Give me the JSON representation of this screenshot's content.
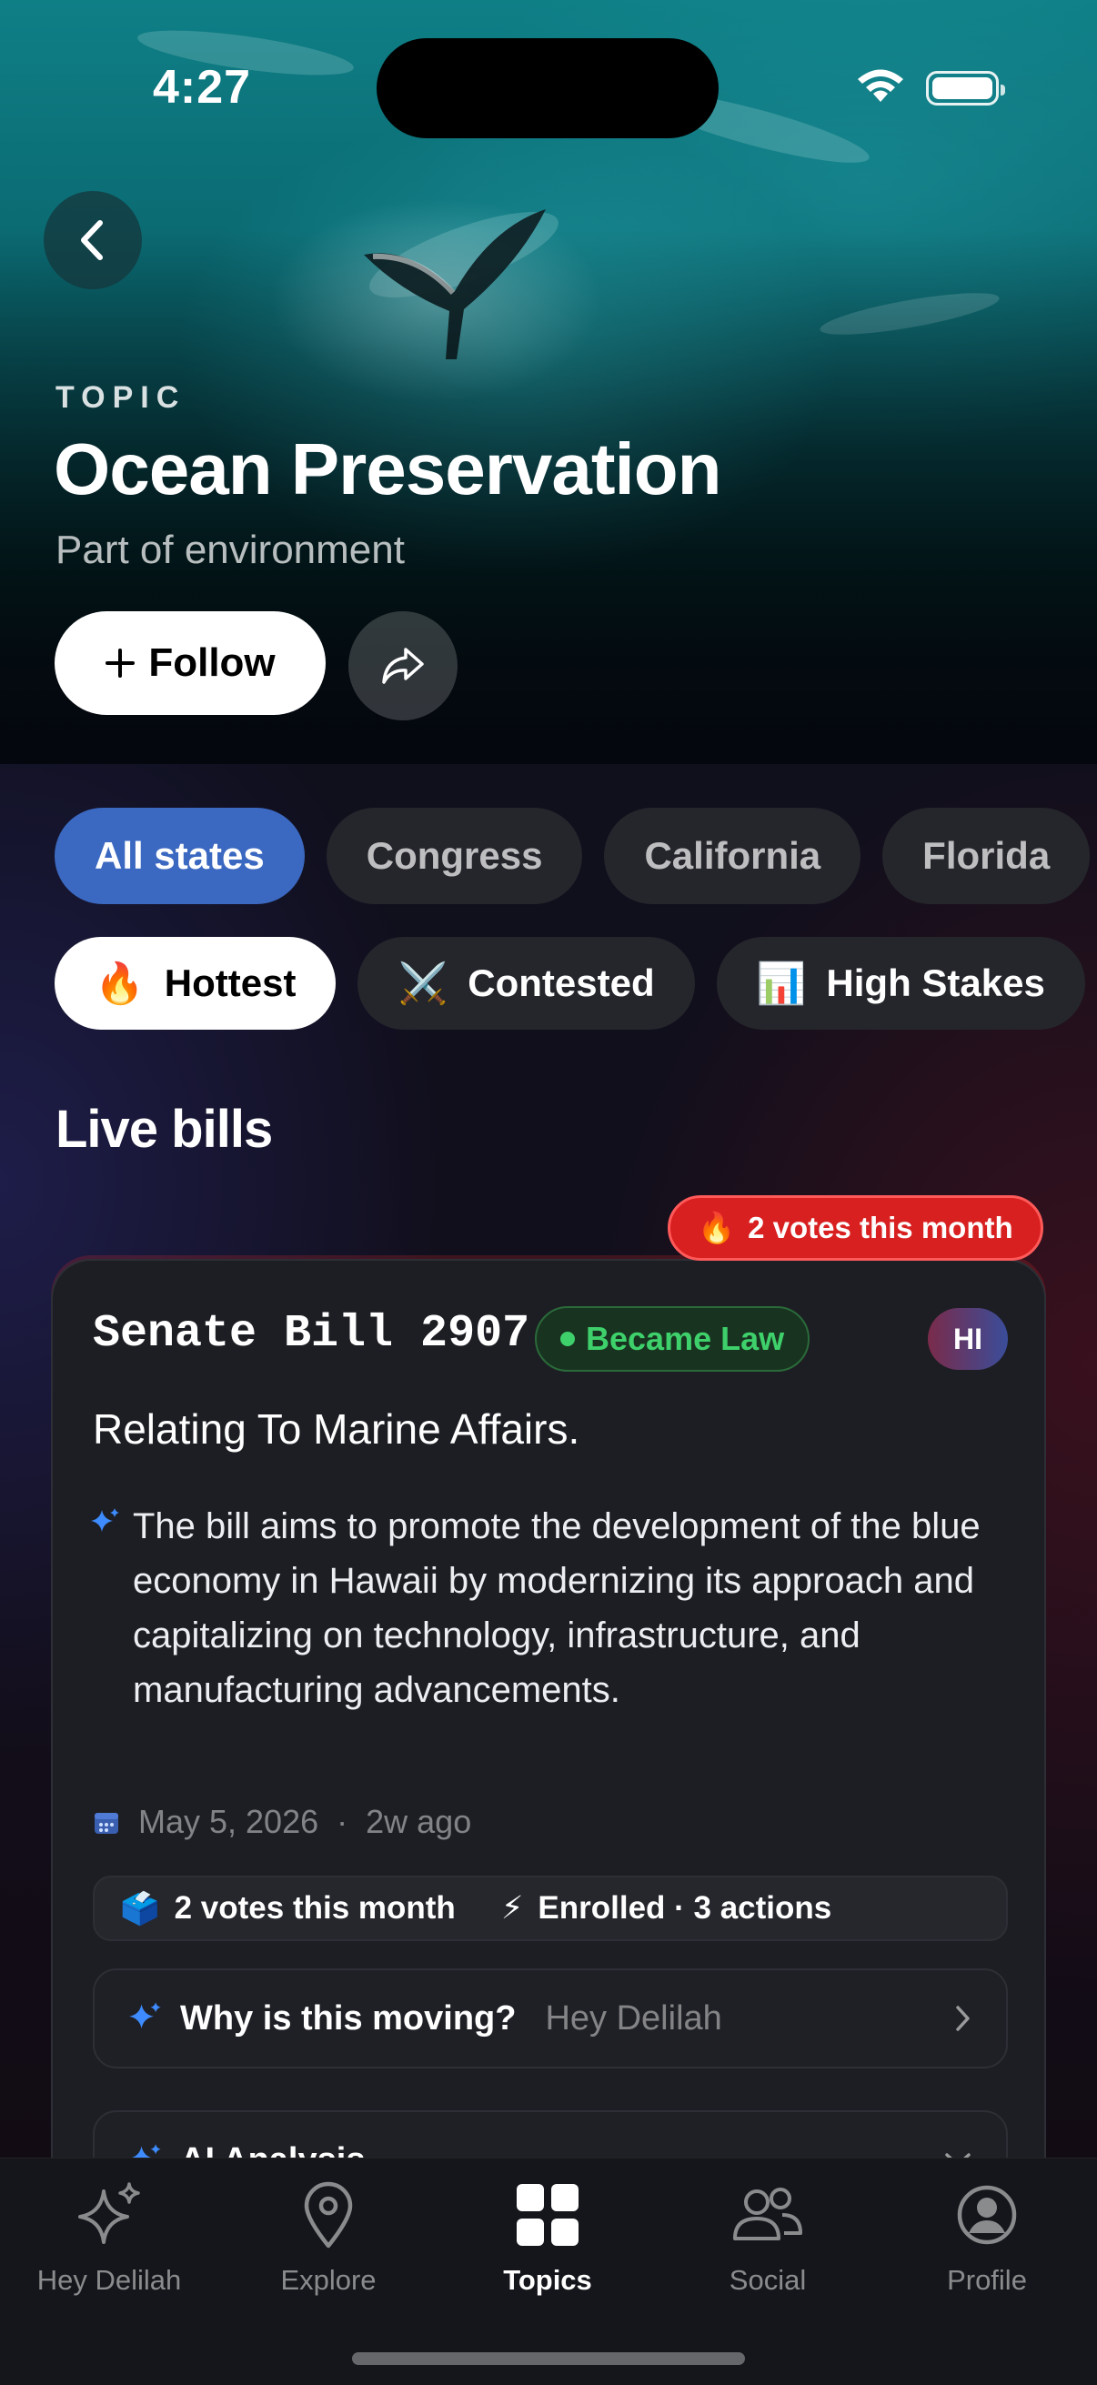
{
  "status_bar": {
    "time": "4:27"
  },
  "hero": {
    "eyebrow": "TOPIC",
    "title": "Ocean Preservation",
    "subtitle": "Part of environment",
    "follow_label": "Follow"
  },
  "state_filters": [
    {
      "label": "All states",
      "active": true
    },
    {
      "label": "Congress",
      "active": false
    },
    {
      "label": "California",
      "active": false
    },
    {
      "label": "Florida",
      "active": false
    }
  ],
  "sort_filters": [
    {
      "emoji": "🔥",
      "label": "Hottest",
      "active": true
    },
    {
      "emoji": "⚔️",
      "label": "Contested",
      "active": false
    },
    {
      "emoji": "📊",
      "label": "High Stakes",
      "active": false
    }
  ],
  "section": {
    "title": "Live bills"
  },
  "bill": {
    "hot_badge": "2 votes this month",
    "hot_emoji": "🔥",
    "number": "Senate Bill 2907",
    "status": "Became Law",
    "state": "HI",
    "title": "Relating To Marine Affairs.",
    "summary": "The bill aims to promote the development of the blue economy in Hawaii by modernizing its approach and capitalizing on technology, infrastructure, and manufacturing advancements.",
    "date": "May 5, 2026",
    "separator": "·",
    "relative": "2w ago",
    "stat_votes_emoji": "🗳️",
    "stat_votes": "2 votes this month",
    "stat_actions_emoji": "⚡",
    "stat_actions": "Enrolled · 3 actions",
    "why_label": "Why is this moving?",
    "why_sub": "Hey Delilah",
    "analysis_label": "AI Analysis"
  },
  "tabs": [
    {
      "label": "Hey Delilah",
      "icon": "sparkles-icon",
      "active": false
    },
    {
      "label": "Explore",
      "icon": "map-pin-icon",
      "active": false
    },
    {
      "label": "Topics",
      "icon": "grid-icon",
      "active": true
    },
    {
      "label": "Social",
      "icon": "people-icon",
      "active": false
    },
    {
      "label": "Profile",
      "icon": "person-circle-icon",
      "active": false
    }
  ],
  "colors": {
    "accent_blue": "#3b68c0",
    "hot_red": "#d92020",
    "law_green": "#3ed06b",
    "sparkle_blue": "#3d8bff"
  }
}
